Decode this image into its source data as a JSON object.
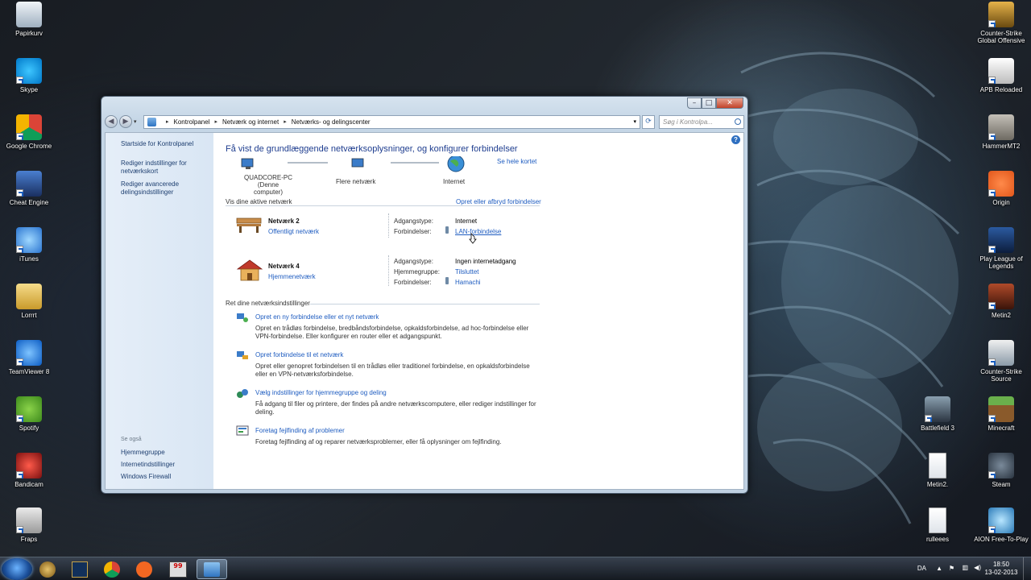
{
  "desktop": {
    "left_icons": [
      {
        "label": "Papirkurv",
        "icon": "recycle-bin-icon"
      },
      {
        "label": "Skype",
        "icon": "skype-icon"
      },
      {
        "label": "Google Chrome",
        "icon": "chrome-icon"
      },
      {
        "label": "Cheat Engine",
        "icon": "cheat-engine-icon"
      },
      {
        "label": "iTunes",
        "icon": "itunes-icon"
      },
      {
        "label": "Lorrrt",
        "icon": "folder-icon"
      },
      {
        "label": "TeamViewer 8",
        "icon": "teamviewer-icon"
      },
      {
        "label": "Spotify",
        "icon": "spotify-icon"
      },
      {
        "label": "Bandicam",
        "icon": "bandicam-icon"
      },
      {
        "label": "Fraps",
        "icon": "fraps-icon"
      }
    ],
    "right_icons": [
      {
        "label": "Counter-Strike Global Offensive",
        "icon": "csgo-icon"
      },
      {
        "label": "APB Reloaded",
        "icon": "apb-icon"
      },
      {
        "label": "HammerMT2",
        "icon": "hammer-icon"
      },
      {
        "label": "Origin",
        "icon": "origin-icon"
      },
      {
        "label": "Play League of Legends",
        "icon": "league-icon"
      },
      {
        "label": "Metin2",
        "icon": "metin2-icon"
      },
      {
        "label": "Counter-Strike Source",
        "icon": "css-icon"
      },
      {
        "label": "Minecraft",
        "icon": "minecraft-icon"
      },
      {
        "label": "Steam",
        "icon": "steam-icon"
      },
      {
        "label": "AION Free-To-Play",
        "icon": "aion-icon"
      }
    ],
    "middle_icons": [
      {
        "label": "Battlefield 3",
        "icon": "battlefield-icon"
      },
      {
        "label": "Metin2.",
        "icon": "document-icon"
      },
      {
        "label": "rulleees",
        "icon": "document-icon"
      }
    ]
  },
  "window": {
    "address": {
      "crumbs": [
        "Kontrolpanel",
        "Netværk og internet",
        "Netværks- og delingscenter"
      ]
    },
    "search_placeholder": "Søg i Kontrolpa...",
    "left_pane": {
      "links": [
        "Startside for Kontrolpanel",
        "Rediger indstillinger for netværkskort",
        "Rediger avancerede delingsindstillinger"
      ],
      "see_also_heading": "Se også",
      "see_also": [
        "Hjemmegruppe",
        "Internetindstillinger",
        "Windows Firewall"
      ]
    },
    "main": {
      "title": "Få vist de grundlæggende netværksoplysninger, og konfigurer forbindelser",
      "see_full_map": "Se hele kortet",
      "map": {
        "computer_name": "QUADCORE-PC",
        "computer_sub": "(Denne computer)",
        "middle": "Flere netværk",
        "end": "Internet"
      },
      "active_networks_heading": "Vis dine aktive netværk",
      "connect_disconnect": "Opret eller afbryd forbindelser",
      "networks": [
        {
          "name": "Netværk  2",
          "type": "Offentligt netværk",
          "rows": [
            {
              "label": "Adgangstype:",
              "value": "Internet",
              "is_link": false
            },
            {
              "label": "Forbindelser:",
              "value": "LAN-forbindelse",
              "is_link": true
            }
          ]
        },
        {
          "name": "Netværk  4",
          "type": "Hjemmenetværk",
          "rows": [
            {
              "label": "Adgangstype:",
              "value": "Ingen internetadgang",
              "is_link": false
            },
            {
              "label": "Hjemmegruppe:",
              "value": "Tilsluttet",
              "is_link": true
            },
            {
              "label": "Forbindelser:",
              "value": "Hamachi",
              "is_link": true
            }
          ]
        }
      ],
      "change_settings_heading": "Ret dine netværksindstillinger",
      "tasks": [
        {
          "title": "Opret en ny forbindelse eller et nyt netværk",
          "desc1": "Opret en trådløs forbindelse, bredbåndsforbindelse, opkaldsforbindelse, ad hoc-forbindelse eller",
          "desc2": "VPN-forbindelse. Eller konfigurer en router eller et adgangspunkt."
        },
        {
          "title": "Opret forbindelse til et netværk",
          "desc1": "Opret eller genopret forbindelsen til en trådløs eller traditionel forbindelse, en opkaldsforbindelse",
          "desc2": "eller en VPN-netværksforbindelse."
        },
        {
          "title": "Vælg indstillinger for hjemmegruppe og deling",
          "desc1": "Få adgang til filer og printere, der findes på andre netværkscomputere, eller rediger indstillinger for",
          "desc2": "deling."
        },
        {
          "title": "Foretag fejlfinding af problemer",
          "desc1": "Foretag fejlfinding af og reparer netværksproblemer, eller få oplysninger om fejlfinding.",
          "desc2": ""
        }
      ]
    }
  },
  "taskbar": {
    "language": "DA",
    "time": "18:50",
    "date": "13-02-2013"
  }
}
